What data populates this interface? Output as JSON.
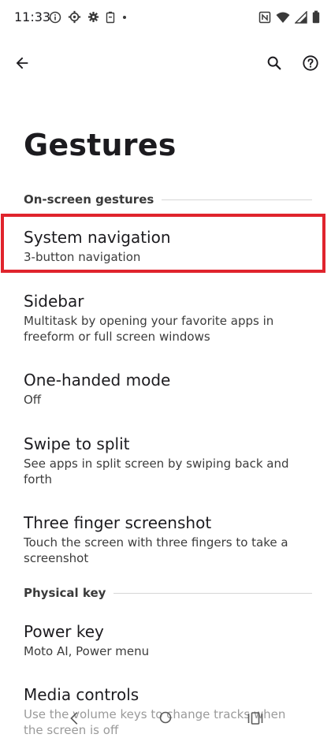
{
  "status_bar": {
    "time": "11:33",
    "left_icons": [
      "info-icon",
      "settings-gear-icon",
      "gear-icon",
      "battery-saver-icon",
      "dot-icon"
    ],
    "right_icons": [
      "nfc-icon",
      "wifi-icon",
      "signal-icon",
      "battery-icon"
    ]
  },
  "top_bar": {
    "back_icon": "arrow-back-icon",
    "search_icon": "search-icon",
    "help_icon": "help-icon"
  },
  "page": {
    "title": "Gestures"
  },
  "sections": [
    {
      "header": "On-screen gestures",
      "items": [
        {
          "title": "System navigation",
          "subtitle": "3-button navigation"
        },
        {
          "title": "Sidebar",
          "subtitle": "Multitask by opening your favorite apps in freeform or full screen windows"
        },
        {
          "title": "One-handed mode",
          "subtitle": "Off"
        },
        {
          "title": "Swipe to split",
          "subtitle": "See apps in split screen by swiping back and forth"
        },
        {
          "title": "Three finger screenshot",
          "subtitle": "Touch the screen with three fingers to take a screenshot"
        }
      ]
    },
    {
      "header": "Physical key",
      "items": [
        {
          "title": "Power key",
          "subtitle": "Moto AI, Power menu"
        },
        {
          "title": "Media controls",
          "subtitle": "Use the volume keys to change tracks when the screen is off"
        }
      ]
    }
  ],
  "highlight_color": "#e0242d",
  "nav_bar": {
    "back_icon": "nav-back-icon",
    "home_icon": "nav-home-icon",
    "recents_icon": "nav-recents-icon"
  }
}
